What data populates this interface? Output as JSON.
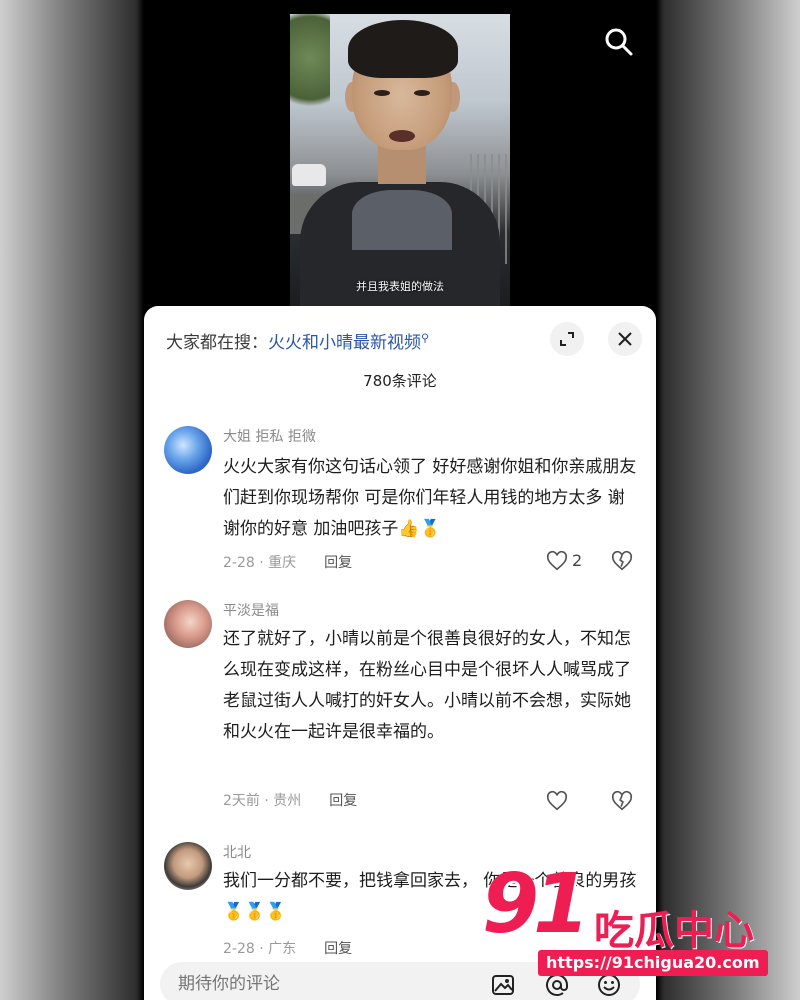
{
  "video": {
    "subtitle": "并且我表姐的做法"
  },
  "search_bar": {
    "prefix": "大家都在搜：",
    "keyword": "火火和小晴最新视频"
  },
  "comments_header": {
    "count": "780条评论"
  },
  "comments": [
    {
      "user": "大姐  拒私  拒微",
      "text": "火火大家有你这句话心领了 好好感谢你姐和你亲戚朋友们赶到你现场帮你 可是你们年轻人用钱的地方太多  谢谢你的好意 加油吧孩子👍🥇",
      "meta": "2-28 · 重庆",
      "reply": "回复",
      "likes": "2"
    },
    {
      "user": "平淡是福",
      "text": "还了就好了，小晴以前是个很善良很好的女人，不知怎么现在变成这样，在粉丝心目中是个很坏人人喊骂成了老鼠过街人人喊打的奸女人。小晴以前不会想，实际她和火火在一起许是很幸福的。",
      "meta": "2天前 · 贵州",
      "reply": "回复",
      "likes": ""
    },
    {
      "user": "北北",
      "text": "我们一分都不要，把钱拿回家去，      你是一个善良的男孩🥇🥇🥇",
      "meta": "2-28 · 广东",
      "reply": "回复",
      "likes": ""
    }
  ],
  "input": {
    "placeholder": "期待你的评论"
  },
  "watermark": {
    "number": "91",
    "name": "吃瓜中心",
    "url": "https://91chigua20.com"
  },
  "colors": {
    "accent": "#ee1d52",
    "link": "#2b57a8"
  }
}
